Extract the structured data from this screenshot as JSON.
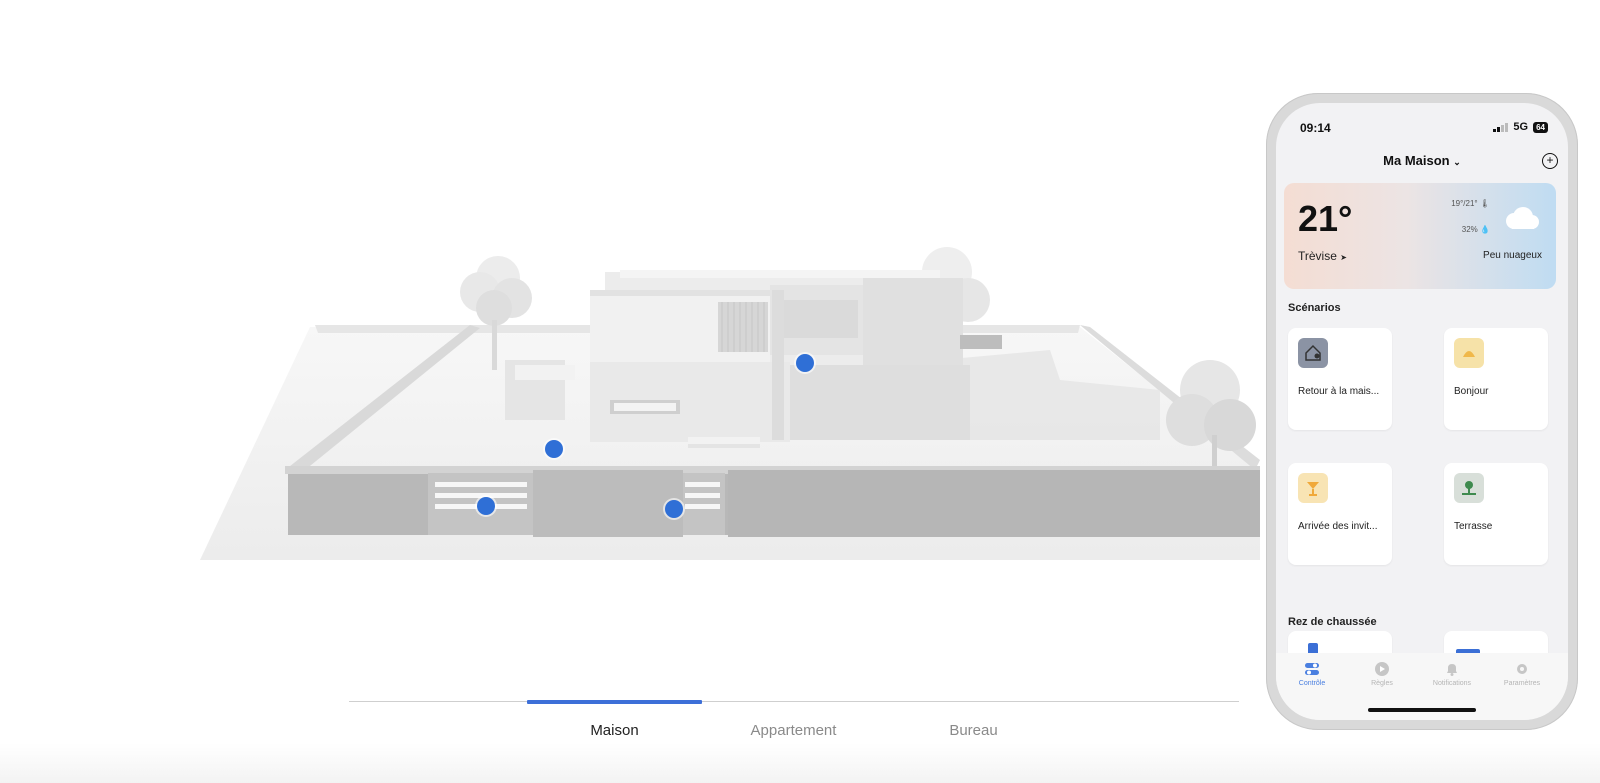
{
  "tabs": [
    "Maison",
    "Appartement",
    "Bureau"
  ],
  "active_tab": "Maison",
  "colors": {
    "accent": "#3d6fd8",
    "hotspot": "#2f6fd6"
  },
  "phone": {
    "status": {
      "time": "09:14",
      "network": "5G",
      "battery": "64"
    },
    "header": {
      "title": "Ma Maison",
      "add_icon": "plus-circle-icon"
    },
    "weather": {
      "temperature": "21°",
      "city": "Trèvise",
      "range": "19°/21°",
      "humidity": "32%",
      "description": "Peu nuageux",
      "icon": "cloud-icon"
    },
    "scenarios_title": "Scénarios",
    "scenarios": [
      {
        "label": "Retour à la mais...",
        "icon": "house-person-icon"
      },
      {
        "label": "Bonjour",
        "icon": "sunrise-icon"
      },
      {
        "label": "Arrivée des invit...",
        "icon": "cocktail-icon"
      },
      {
        "label": "Terrasse",
        "icon": "tree-icon"
      }
    ],
    "room_title": "Rez de chaussée",
    "tabbar": [
      {
        "label": "Contrôle",
        "icon": "toggle-icon"
      },
      {
        "label": "Règles",
        "icon": "play-icon"
      },
      {
        "label": "Notifications",
        "icon": "bell-icon"
      },
      {
        "label": "Paramètres",
        "icon": "gear-icon"
      }
    ]
  }
}
